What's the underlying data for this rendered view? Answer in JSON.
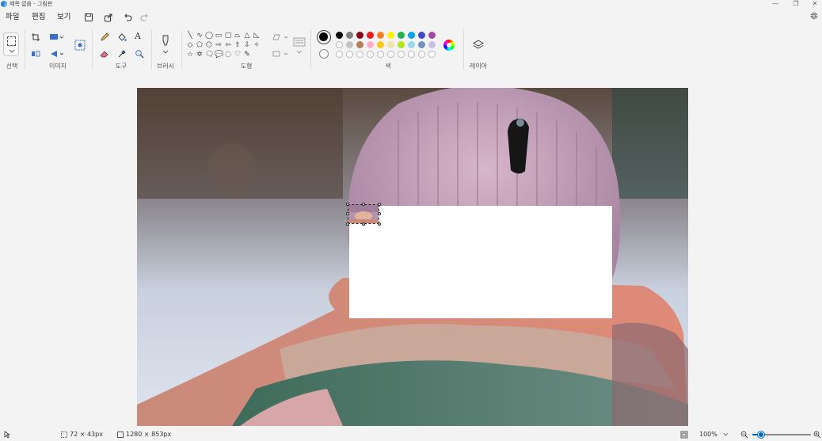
{
  "window": {
    "title": "제목 없음 - 그림판",
    "minimize_glyph": "—",
    "restore_glyph": "❐",
    "close_glyph": "✕"
  },
  "menu": {
    "file": "파일",
    "edit": "편집",
    "view": "보기"
  },
  "ribbon": {
    "groups": {
      "selection": "선택",
      "image": "이미지",
      "tools": "도구",
      "brushes": "브러시",
      "shapes": "도형",
      "colors": "색",
      "layers": "레이어"
    },
    "text_tool_glyph": "A"
  },
  "colors": {
    "primary": "#000000",
    "secondary": "#ffffff",
    "palette_row1": [
      "#000000",
      "#7f7f7f",
      "#880015",
      "#ed1c24",
      "#ff7f27",
      "#fff200",
      "#22b14c",
      "#00a2e8",
      "#3f48cc",
      "#a349a4"
    ],
    "palette_row2": [
      "#ffffff",
      "#c3c3c3",
      "#b97a57",
      "#ffaec9",
      "#ffc90e",
      "#efe4b0",
      "#b5e61d",
      "#99d9ea",
      "#7092be",
      "#c8bfe7"
    ],
    "accent": "#0067c0"
  },
  "shapes": {
    "row1": [
      "╲",
      "∿",
      "◯",
      "▭",
      "▢",
      "⏢",
      "△",
      "◺"
    ],
    "row2": [
      "◇",
      "⬠",
      "⬡",
      "⇨",
      "⇦",
      "⇧",
      "⇩",
      "✧"
    ],
    "row3": [
      "☆",
      "✡",
      "🗨",
      "💬",
      "◌",
      "♡",
      "✎"
    ]
  },
  "status": {
    "selection_size": "72 × 43px",
    "canvas_size": "1280 × 853px",
    "zoom": "100%",
    "zoom_level": 0.5
  }
}
